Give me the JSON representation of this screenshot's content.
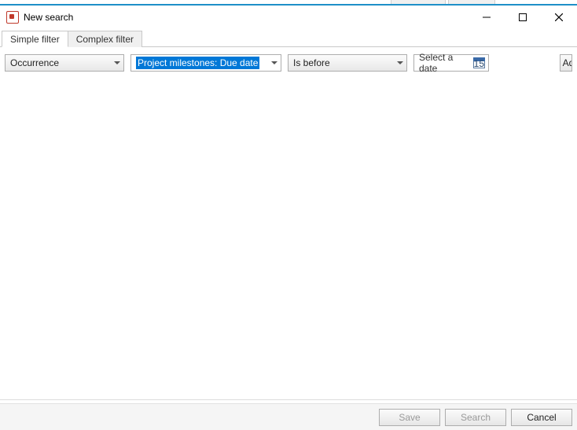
{
  "window": {
    "title": "New search"
  },
  "tabs": {
    "simple": "Simple filter",
    "complex": "Complex filter"
  },
  "filter": {
    "occurrence_label": "Occurrence",
    "field_value": "Project milestones: Due date",
    "operator_value": "Is before",
    "date_placeholder": "Select a date",
    "calendar_day": "15",
    "add_label": "Ad"
  },
  "footer": {
    "save": "Save",
    "search": "Search",
    "cancel": "Cancel"
  }
}
